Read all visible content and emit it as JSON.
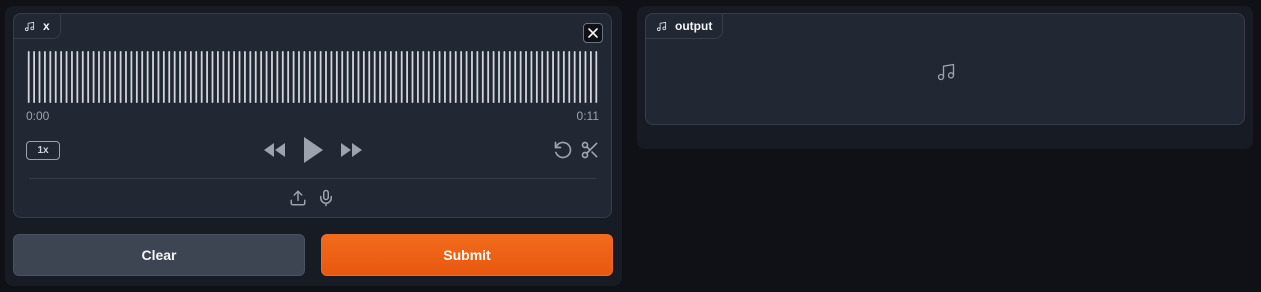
{
  "input": {
    "label": "x",
    "time_start": "0:00",
    "time_end": "0:11",
    "speed": "1x",
    "progress": 0
  },
  "buttons": {
    "clear": "Clear",
    "submit": "Submit"
  },
  "output": {
    "label": "output"
  },
  "icons": {
    "label": "music-note-icon",
    "close": "close-icon",
    "rewind": "rewind-icon",
    "play": "play-icon",
    "forward": "fast-forward-icon",
    "undo": "undo-icon",
    "trim": "scissors-icon",
    "upload": "upload-icon",
    "mic": "microphone-icon",
    "empty": "music-note-icon"
  },
  "colors": {
    "accent": "#f26b1c",
    "background": "#0f1117",
    "panel": "#212733"
  }
}
